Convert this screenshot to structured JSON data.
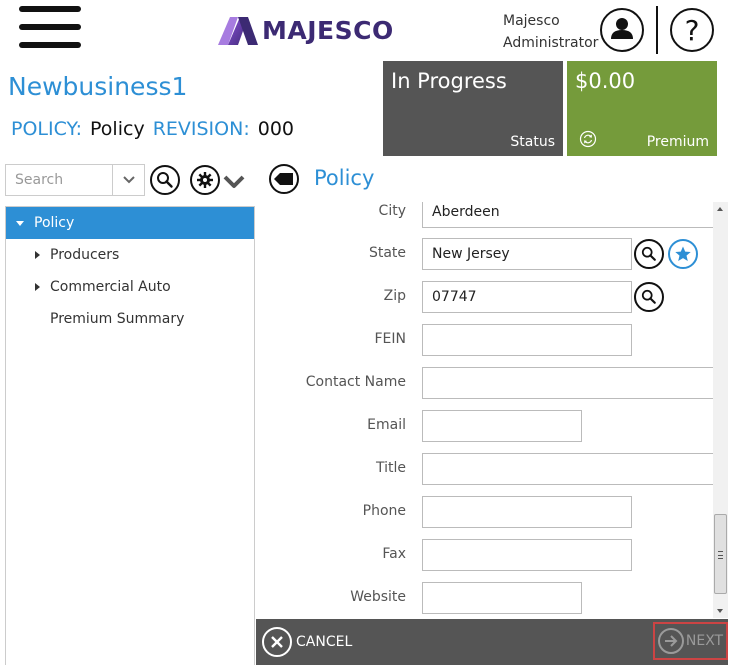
{
  "header": {
    "logo_text": "MAJESCO",
    "user_name_line1": "Majesco",
    "user_name_line2": "Administrator",
    "help_glyph": "?",
    "brand_color": "#3c2a73",
    "accent_color": "#2d8fd5"
  },
  "page": {
    "title": "Newbusiness1",
    "policy_label": "POLICY:",
    "policy_value": "Policy",
    "revision_label": "REVISION:",
    "revision_value": "000"
  },
  "tiles": {
    "status_value": "In Progress",
    "status_caption": "Status",
    "status_color": "#555555",
    "premium_value": "$0.00",
    "premium_caption": "Premium",
    "premium_color": "#759b3b"
  },
  "toolbar": {
    "search_placeholder": "Search",
    "section_title": "Policy"
  },
  "tree": {
    "items": [
      {
        "label": "Policy",
        "expanded": true,
        "active": true
      },
      {
        "label": "Producers",
        "expandable": true
      },
      {
        "label": "Commercial Auto",
        "expandable": true
      },
      {
        "label": "Premium Summary",
        "expandable": false
      }
    ]
  },
  "form": {
    "fields": [
      {
        "label": "City",
        "value": "Aberdeen"
      },
      {
        "label": "State",
        "value": "New Jersey"
      },
      {
        "label": "Zip",
        "value": "07747"
      },
      {
        "label": "FEIN",
        "value": ""
      },
      {
        "label": "Contact Name",
        "value": ""
      },
      {
        "label": "Email",
        "value": ""
      },
      {
        "label": "Title",
        "value": ""
      },
      {
        "label": "Phone",
        "value": ""
      },
      {
        "label": "Fax",
        "value": ""
      },
      {
        "label": "Website",
        "value": ""
      }
    ]
  },
  "footer": {
    "cancel_label": "CANCEL",
    "next_label": "NEXT"
  },
  "icons": [
    "hamburger-icon",
    "user-icon",
    "help-icon",
    "search-icon",
    "gear-icon",
    "chevron-down-icon",
    "back-icon",
    "refresh-icon",
    "star-icon",
    "close-icon",
    "arrow-right-icon"
  ]
}
